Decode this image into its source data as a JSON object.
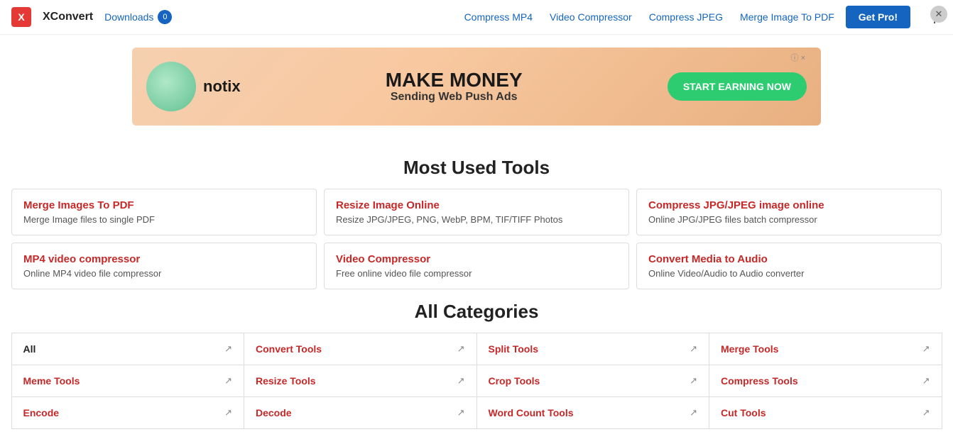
{
  "header": {
    "logo_text": "X",
    "brand_name": "XConvert",
    "downloads_label": "Downloads",
    "downloads_count": "0",
    "nav_links": [
      {
        "label": "Compress MP4",
        "id": "compress-mp4"
      },
      {
        "label": "Video Compressor",
        "id": "video-compressor"
      },
      {
        "label": "Compress JPEG",
        "id": "compress-jpeg"
      },
      {
        "label": "Merge Image To PDF",
        "id": "merge-image-to-pdf"
      }
    ],
    "get_pro_label": "Get Pro!"
  },
  "ad": {
    "brand": "notix",
    "headline": "MAKE MONEY",
    "subline": "Sending Web Push Ads",
    "cta": "START EARNING NOW",
    "info": "i ×"
  },
  "most_used_section": {
    "title": "Most Used Tools",
    "tools": [
      {
        "title": "Merge Images To PDF",
        "desc": "Merge Image files to single PDF"
      },
      {
        "title": "Resize Image Online",
        "desc": "Resize JPG/JPEG, PNG, WebP, BPM, TIF/TIFF Photos"
      },
      {
        "title": "Compress JPG/JPEG image online",
        "desc": "Online JPG/JPEG files batch compressor"
      },
      {
        "title": "MP4 video compressor",
        "desc": "Online MP4 video file compressor"
      },
      {
        "title": "Video Compressor",
        "desc": "Free online video file compressor"
      },
      {
        "title": "Convert Media to Audio",
        "desc": "Online Video/Audio to Audio converter"
      }
    ]
  },
  "categories_section": {
    "title": "All Categories",
    "categories": [
      {
        "label": "All",
        "is_black": true,
        "row": 1,
        "col": 1
      },
      {
        "label": "Convert Tools",
        "is_black": false,
        "row": 1,
        "col": 2
      },
      {
        "label": "Split Tools",
        "is_black": false,
        "row": 1,
        "col": 3
      },
      {
        "label": "Merge Tools",
        "is_black": false,
        "row": 1,
        "col": 4
      },
      {
        "label": "Meme Tools",
        "is_black": false,
        "row": 2,
        "col": 1
      },
      {
        "label": "Resize Tools",
        "is_black": false,
        "row": 2,
        "col": 2
      },
      {
        "label": "Crop Tools",
        "is_black": false,
        "row": 2,
        "col": 3
      },
      {
        "label": "Compress Tools",
        "is_black": false,
        "row": 2,
        "col": 4
      },
      {
        "label": "Encode",
        "is_black": false,
        "row": 3,
        "col": 1
      },
      {
        "label": "Decode",
        "is_black": false,
        "row": 3,
        "col": 2
      },
      {
        "label": "Word Count Tools",
        "is_black": false,
        "row": 3,
        "col": 3
      },
      {
        "label": "Cut Tools",
        "is_black": false,
        "row": 3,
        "col": 4
      }
    ]
  }
}
